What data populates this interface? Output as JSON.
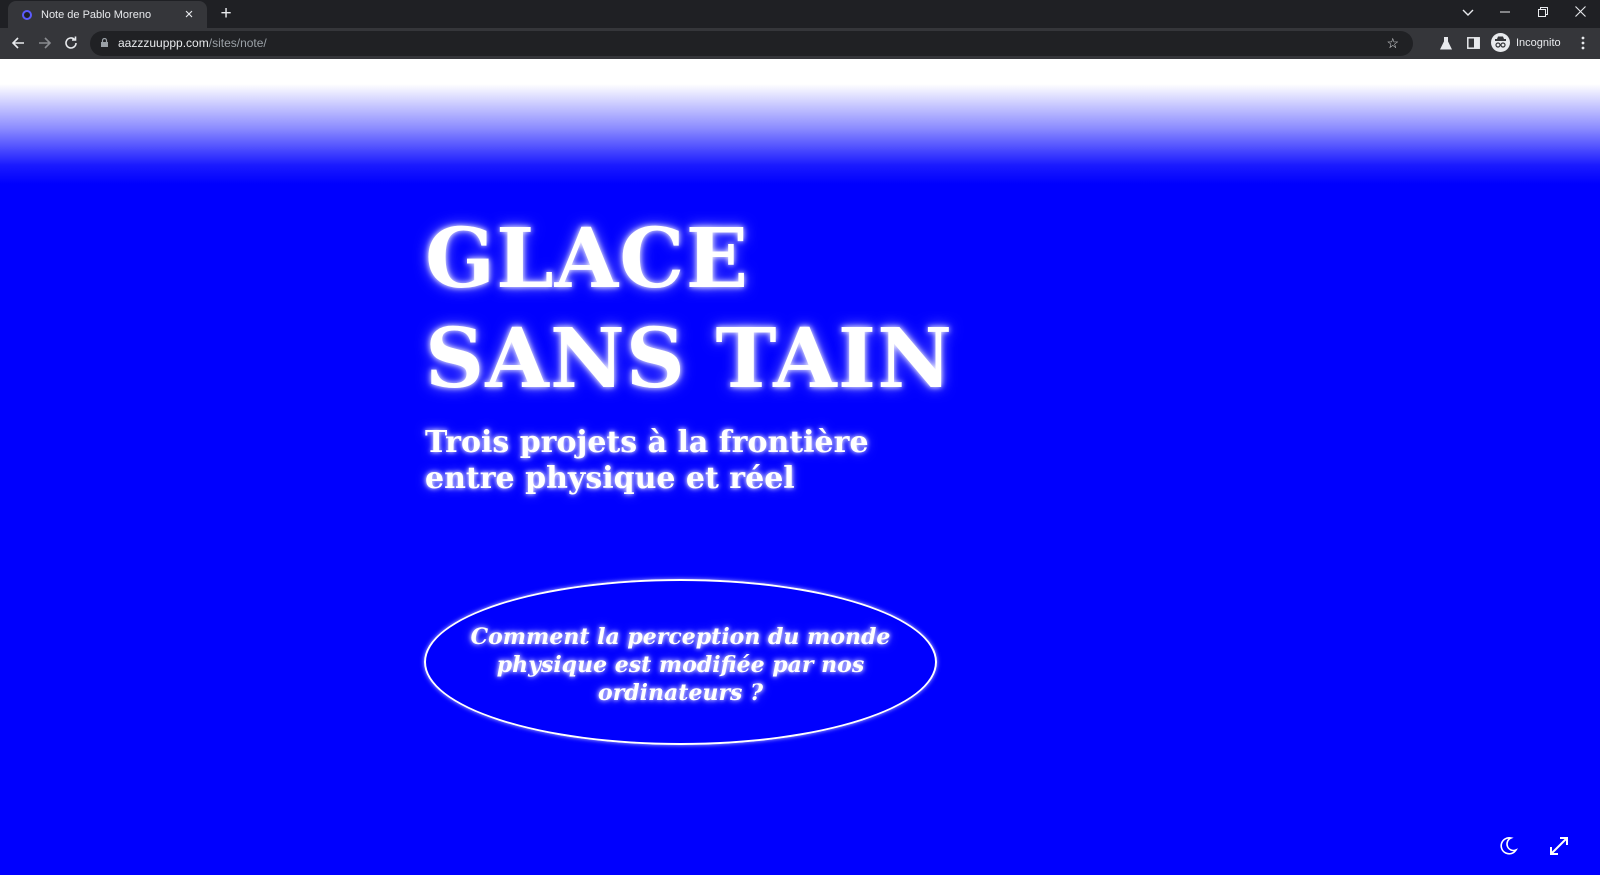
{
  "browser": {
    "tab": {
      "title": "Note de Pablo Moreno",
      "close_icon": "close-icon"
    },
    "new_tab_icon": "plus-icon",
    "window_controls": [
      "chevron-down-icon",
      "minimize-icon",
      "restore-icon",
      "close-icon"
    ],
    "address": {
      "domain": "aazzzuuppp.com",
      "path": "/sites/note/"
    },
    "profile_label": "Incognito"
  },
  "page": {
    "title_line1": "GLACE",
    "title_line2": "SANS TAIN",
    "subtitle": "Trois projets à la frontière entre physique et réel",
    "question": "Comment la perception du monde physique est modifiée par nos ordinateurs ?",
    "corner_icons": [
      "moon-icon",
      "expand-icon"
    ],
    "colors": {
      "background": "#0000fe",
      "text": "#ffffff"
    }
  }
}
